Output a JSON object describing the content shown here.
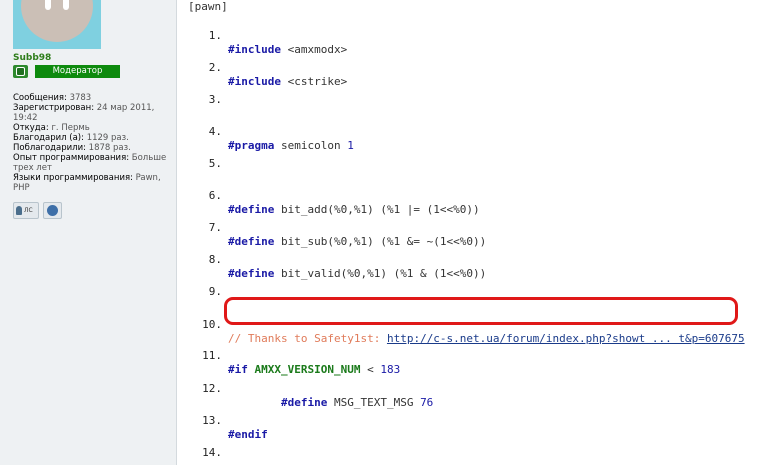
{
  "user": {
    "name": "Subb98",
    "rank": "Модератор",
    "stats": [
      {
        "label": "Сообщения:",
        "value": "3783"
      },
      {
        "label": "Зарегистрирован:",
        "value": "24 мар 2011, 19:42"
      },
      {
        "label": "Откуда:",
        "value": "г. Пермь"
      },
      {
        "label": "Благодарил (а):",
        "value": "1129 раз."
      },
      {
        "label": "Поблагодарили:",
        "value": "1878 раз."
      },
      {
        "label": "Опыт программирования:",
        "value": "Больше трех лет"
      },
      {
        "label": "Языки программирования:",
        "value": "Pawn, PHP"
      }
    ],
    "pm_label": "ЛС",
    "avatar_icon": "cat-avatar",
    "web_icon": "globe-icon"
  },
  "code": {
    "tag": "[pawn]",
    "lines": [
      {
        "n": "1.",
        "kw": "#include",
        "rest": " <amxmodx>"
      },
      {
        "n": "2.",
        "kw": "#include",
        "rest": " <cstrike>"
      },
      {
        "n": "3.",
        "kw": "",
        "rest": ""
      },
      {
        "n": "4.",
        "kw": "#pragma",
        "rest": " semicolon ",
        "num": "1"
      },
      {
        "n": "5.",
        "kw": "",
        "rest": ""
      },
      {
        "n": "6.",
        "kw": "#define",
        "rest": " bit_add(%0,%1) (%1 |= (1<<%0))"
      },
      {
        "n": "7.",
        "kw": "#define",
        "rest": " bit_sub(%0,%1) (%1 &= ~(1<<%0))"
      },
      {
        "n": "8.",
        "kw": "#define",
        "rest": " bit_valid(%0,%1) (%1 & (1<<%0))"
      },
      {
        "n": "9.",
        "kw": "",
        "rest": ""
      },
      {
        "n": "10.",
        "comment": "// Thanks to Safety1st: ",
        "link": "http://c-s.net.ua/forum/index.php?showt ... t&p=607675"
      },
      {
        "n": "11.",
        "kw": "#if",
        "green": "AMXX_VERSION_NUM",
        "rest": " < ",
        "num": "183"
      },
      {
        "n": "12.",
        "indent": "        ",
        "kw": "#define",
        "rest": " MSG_TEXT_MSG ",
        "num": "76"
      },
      {
        "n": "13.",
        "kw": "#endif",
        "rest": ""
      },
      {
        "n": "14.",
        "kw": "",
        "rest": ""
      }
    ]
  },
  "colors": {
    "highlight_border": "#e01818",
    "rank_bg": "#0d8a0d",
    "username": "#2e7d1a"
  }
}
